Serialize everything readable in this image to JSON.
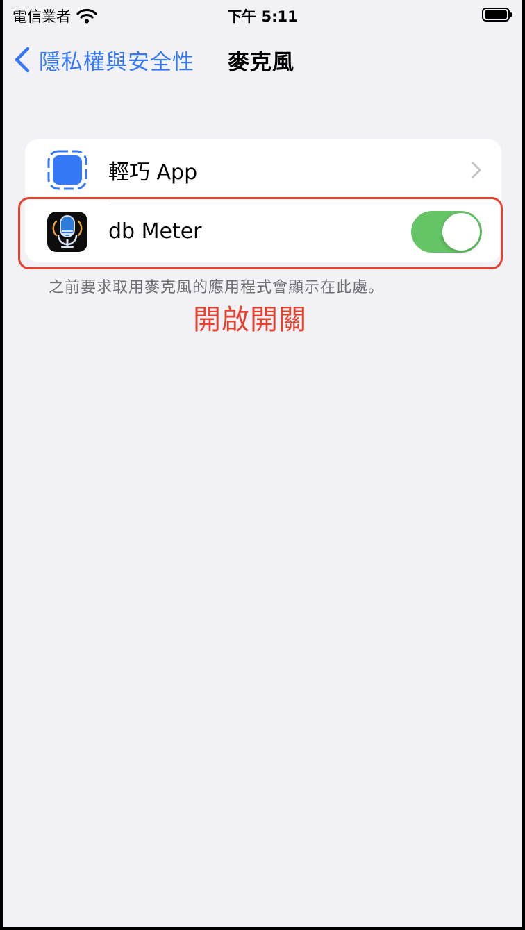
{
  "status_bar": {
    "carrier": "電信業者",
    "time": "下午 5:11"
  },
  "nav": {
    "back_label": "隱私權與安全性",
    "title": "麥克風"
  },
  "apps": [
    {
      "name": "輕巧 App",
      "icon": "placeholder-app-icon",
      "control": "chevron"
    },
    {
      "name": "db Meter",
      "icon": "microphone-app-icon",
      "control": "toggle",
      "enabled": true
    }
  ],
  "footer_note": "之前要求取用麥克風的應用程式會顯示在此處。",
  "annotation": {
    "label": "開啟開關",
    "color": "#e5412e"
  },
  "colors": {
    "accent": "#3478f6",
    "toggle_on": "#65c466",
    "background": "#f2f1f6"
  }
}
